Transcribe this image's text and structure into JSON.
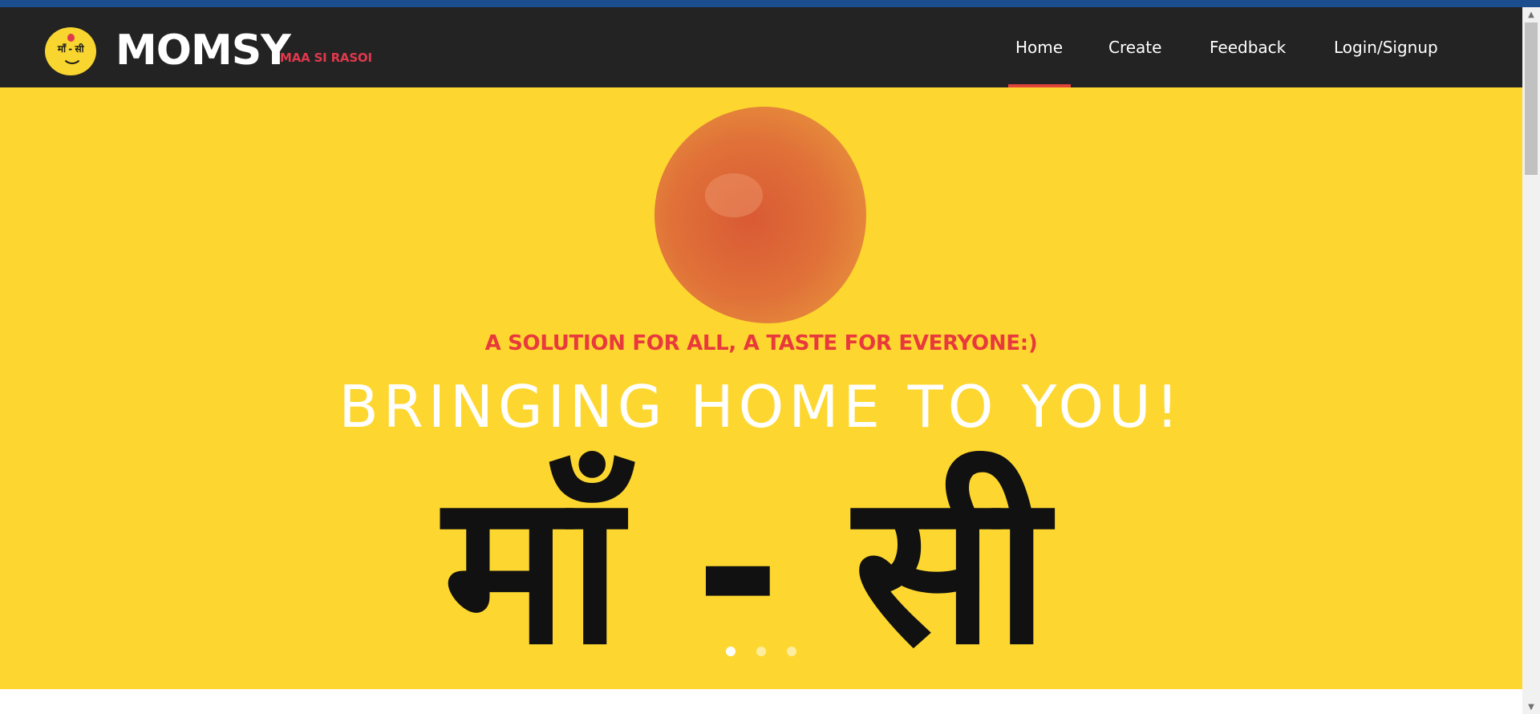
{
  "window": {
    "title": "MOMSY"
  },
  "brand": {
    "name": "MOMSY",
    "tagline": "MAA SI RASOI",
    "logo_text": "माँ - सी"
  },
  "nav": {
    "items": [
      {
        "label": "Home",
        "active": true
      },
      {
        "label": "Create",
        "active": false
      },
      {
        "label": "Feedback",
        "active": false
      },
      {
        "label": "Login/Signup",
        "active": false
      }
    ]
  },
  "hero": {
    "tagline": "A SOLUTION FOR ALL, A TASTE FOR EVERYONE:)",
    "headline": "BRINGING HOME TO YOU!",
    "artwork_text": "माँ - सी",
    "background_color": "#fdd72f",
    "tagline_color": "#e8393c",
    "slides": [
      {
        "active": true
      },
      {
        "active": false
      },
      {
        "active": false
      }
    ]
  },
  "colors": {
    "navbar": "#232323",
    "accent": "#e2433a",
    "top_strip": "#1c4d8f"
  }
}
